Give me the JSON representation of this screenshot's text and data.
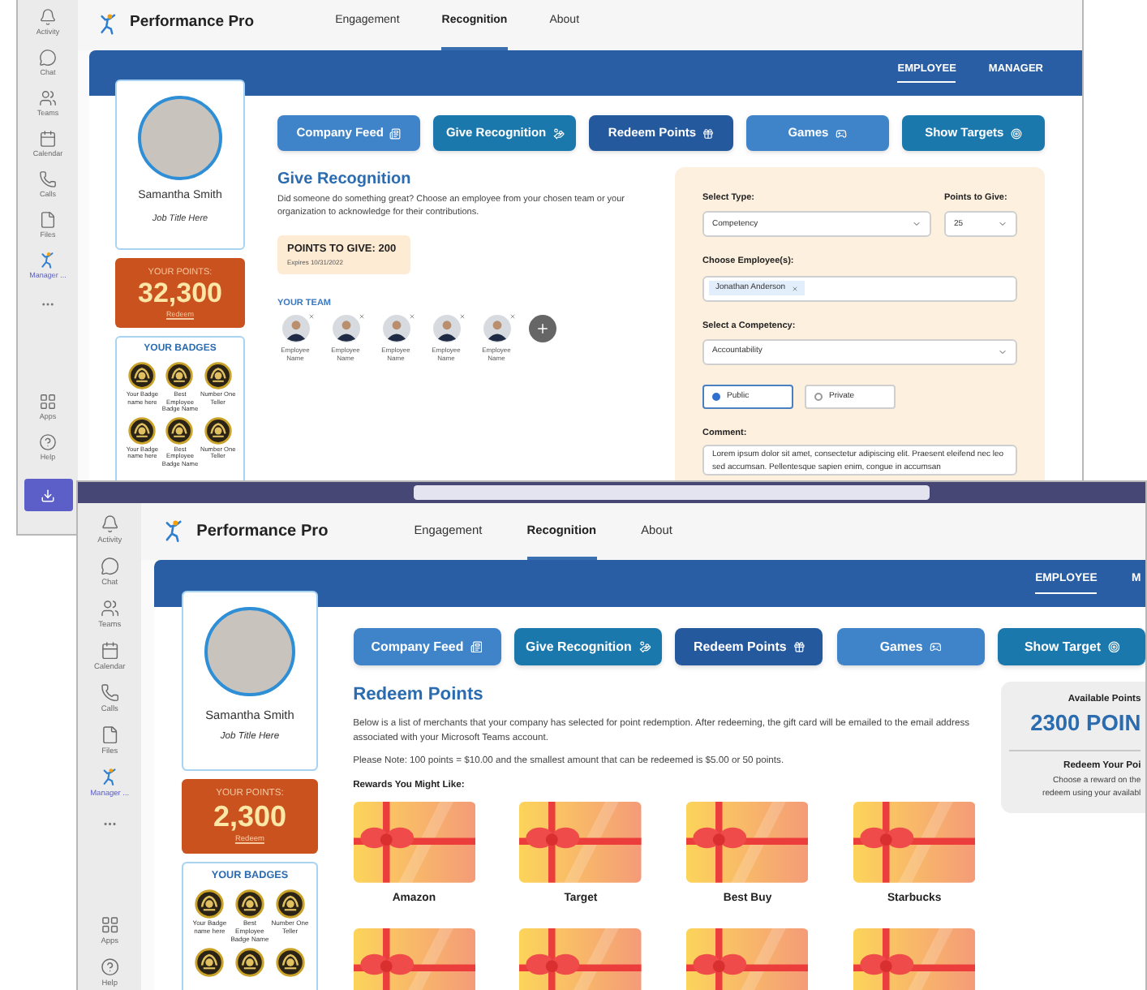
{
  "windows": [
    {
      "kind": "give_recognition",
      "rail": [
        {
          "kind": "app",
          "label": "Activity",
          "selected": false
        },
        {
          "kind": "app",
          "label": "Chat",
          "selected": false
        },
        {
          "kind": "app",
          "label": "Teams",
          "selected": false
        },
        {
          "kind": "app",
          "label": "Calendar",
          "selected": false
        },
        {
          "kind": "app",
          "label": "Calls",
          "selected": false
        },
        {
          "kind": "app",
          "label": "Files",
          "selected": false
        },
        {
          "kind": "app",
          "label": "Manager ...",
          "selected": true
        },
        {
          "kind": "more"
        },
        {
          "kind": "app",
          "label": "Apps",
          "selected": false
        },
        {
          "kind": "app",
          "label": "Help",
          "selected": false
        },
        {
          "kind": "download"
        }
      ],
      "app_name": "Performance Pro",
      "nav": [
        {
          "label": "Engagement",
          "selected": false
        },
        {
          "label": "Recognition",
          "selected": true
        },
        {
          "label": "About",
          "selected": false
        }
      ],
      "role_tabs": [
        {
          "label": "EMPLOYEE",
          "selected": true
        },
        {
          "label": "MANAGER",
          "selected": false
        }
      ],
      "profile": {
        "name": "Samantha Smith",
        "job_title": "Job Title Here"
      },
      "points": {
        "label": "YOUR POINTS:",
        "value": "32,300",
        "link": "Redeem"
      },
      "badges": {
        "title": "YOUR BADGES",
        "items": [
          {
            "name": "Your Badge name here"
          },
          {
            "name": "Best Employee Badge Name"
          },
          {
            "name": "Number One Teller"
          },
          {
            "name": "Your Badge name here"
          },
          {
            "name": "Best Employee Badge Name"
          },
          {
            "name": "Number One Teller"
          }
        ]
      },
      "actions": [
        {
          "label": "Company Feed",
          "color": "#3f83c8"
        },
        {
          "label": "Give Recognition",
          "color": "#1a78ad"
        },
        {
          "label": "Redeem Points",
          "color": "#25599e"
        },
        {
          "label": "Games",
          "color": "#3f83c8"
        },
        {
          "label": "Show Targets",
          "color": "#1a78ad"
        }
      ],
      "panel": {
        "title": "Give Recognition",
        "description": "Did someone do something great? Choose an employee from your chosen team or your organization to acknowledge for their contributions.",
        "points_box": {
          "label": "POINTS TO GIVE: 200",
          "note": "Expires 10/31/2022"
        },
        "team_title": "YOUR TEAM",
        "team": [
          {
            "name": "Employee Name"
          },
          {
            "name": "Employee Name"
          },
          {
            "name": "Employee Name"
          },
          {
            "name": "Employee Name"
          },
          {
            "name": "Employee Name"
          }
        ],
        "select_type": {
          "label": "Select Type:",
          "value": "Competency"
        },
        "points_to_give": {
          "label": "Points to Give:",
          "value": "25"
        },
        "employees": {
          "label": "Choose Employee(s):",
          "tags": [
            "Jonathan Anderson"
          ]
        },
        "competency": {
          "label": "Select a Competency:",
          "value": "Accountability"
        },
        "visibility": [
          {
            "label": "Public",
            "selected": true
          },
          {
            "label": "Private",
            "selected": false
          }
        ],
        "comment": {
          "label": "Comment:",
          "value": "Lorem ipsum dolor sit amet, consectetur adipiscing elit. Praesent eleifend nec leo sed accumsan. Pellentesque sapien enim, congue in accumsan"
        }
      }
    },
    {
      "kind": "redeem_points",
      "rail": [
        {
          "kind": "app",
          "label": "Activity",
          "selected": false
        },
        {
          "kind": "app",
          "label": "Chat",
          "selected": false
        },
        {
          "kind": "app",
          "label": "Teams",
          "selected": false
        },
        {
          "kind": "app",
          "label": "Calendar",
          "selected": false
        },
        {
          "kind": "app",
          "label": "Calls",
          "selected": false
        },
        {
          "kind": "app",
          "label": "Files",
          "selected": false
        },
        {
          "kind": "app",
          "label": "Manager ...",
          "selected": true
        },
        {
          "kind": "more"
        },
        {
          "kind": "app",
          "label": "Apps",
          "selected": false
        },
        {
          "kind": "app",
          "label": "Help",
          "selected": false
        }
      ],
      "app_name": "Performance Pro",
      "nav": [
        {
          "label": "Engagement",
          "selected": false
        },
        {
          "label": "Recognition",
          "selected": true
        },
        {
          "label": "About",
          "selected": false
        }
      ],
      "role_tabs": [
        {
          "label": "EMPLOYEE",
          "selected": true
        },
        {
          "label": "M",
          "selected": false
        }
      ],
      "profile": {
        "name": "Samantha Smith",
        "job_title": "Job Title Here"
      },
      "points": {
        "label": "YOUR POINTS:",
        "value": "2,300",
        "link": "Redeem"
      },
      "badges": {
        "title": "YOUR BADGES",
        "items": [
          {
            "kind": "labeled",
            "name": "Your Badge name here"
          },
          {
            "kind": "labeled",
            "name": "Best Employee Badge Name"
          },
          {
            "kind": "labeled",
            "name": "Number One Teller"
          },
          {
            "kind": "unlabeled"
          },
          {
            "kind": "unlabeled"
          },
          {
            "kind": "unlabeled"
          }
        ]
      },
      "actions": [
        {
          "label": "Company Feed",
          "color": "#3f83c8"
        },
        {
          "label": "Give Recognition",
          "color": "#1a78ad"
        },
        {
          "label": "Redeem Points",
          "color": "#25599e"
        },
        {
          "label": "Games",
          "color": "#3f83c8"
        },
        {
          "label": "Show Target",
          "color": "#1a78ad"
        }
      ],
      "panel": {
        "title": "Redeem Points",
        "paragraphs": [
          "Below is a list of merchants that your company has selected for point redemption. After redeeming, the gift card will be emailed to the email address associated with your Microsoft Teams account.",
          "Please Note: 100 points = $10.00 and the smallest amount that can be redeemed is $5.00 or 50 points."
        ],
        "rewards_title": "Rewards You Might Like:",
        "rewards": [
          {
            "kind": "labeled",
            "name": "Amazon"
          },
          {
            "kind": "labeled",
            "name": "Target"
          },
          {
            "kind": "labeled",
            "name": "Best Buy"
          },
          {
            "kind": "labeled",
            "name": "Starbucks"
          },
          {
            "kind": "unlabeled"
          },
          {
            "kind": "unlabeled"
          },
          {
            "kind": "unlabeled"
          },
          {
            "kind": "unlabeled"
          }
        ],
        "summary": {
          "title": "Available Points",
          "value": "2300 POIN",
          "subtitle": "Redeem Your Poi",
          "lines": [
            "Choose a reward on the",
            "redeem using your availabl"
          ]
        }
      }
    }
  ]
}
